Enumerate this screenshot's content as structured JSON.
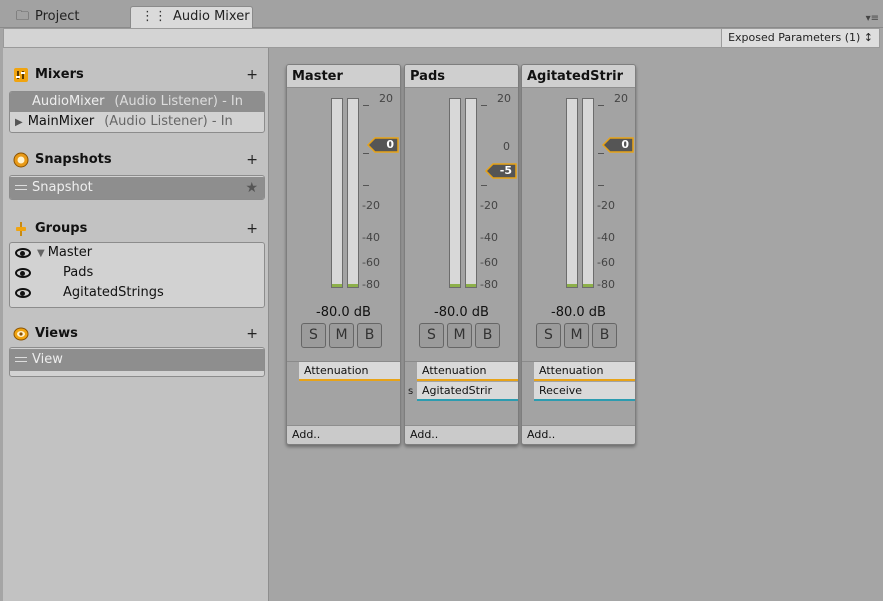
{
  "tabs": [
    {
      "label": "Project",
      "icon": "folder-icon"
    },
    {
      "label": "Audio Mixer",
      "icon": "mixer-icon"
    }
  ],
  "toolbar": {
    "exposed_parameters": "Exposed Parameters (1) ↕"
  },
  "mixers": {
    "title": "Mixers",
    "add": "+",
    "items": [
      {
        "name": "AudioMixer",
        "detail": "(Audio Listener) - In"
      },
      {
        "name": "MainMixer",
        "detail": "(Audio Listener) - In"
      }
    ]
  },
  "snapshots": {
    "title": "Snapshots",
    "add": "+",
    "items": [
      {
        "name": "Snapshot",
        "star": "★"
      }
    ]
  },
  "groups": {
    "title": "Groups",
    "add": "+",
    "items": [
      {
        "name": "Master",
        "arrow": "▼"
      },
      {
        "name": "Pads"
      },
      {
        "name": "AgitatedStrings"
      }
    ]
  },
  "views": {
    "title": "Views",
    "add": "+",
    "items": [
      {
        "name": "View"
      }
    ]
  },
  "strips": [
    {
      "title": "Master",
      "fader_value": "0",
      "level": "-80.0 dB",
      "buttons": [
        "S",
        "M",
        "B"
      ],
      "effects": [
        {
          "label": "Attenuation",
          "color": "#e8a317"
        }
      ],
      "add": "Add.."
    },
    {
      "title": "Pads",
      "fader_value": "-5",
      "level": "-80.0 dB",
      "buttons": [
        "S",
        "M",
        "B"
      ],
      "send_marker": "s",
      "effects": [
        {
          "label": "Attenuation",
          "color": "#e8a317"
        },
        {
          "label": "AgitatedStrir",
          "color": "#2c9cb0"
        }
      ],
      "add": "Add.."
    },
    {
      "title": "AgitatedStrir",
      "fader_value": "0",
      "level": "-80.0 dB",
      "buttons": [
        "S",
        "M",
        "B"
      ],
      "effects": [
        {
          "label": "Attenuation",
          "color": "#e8a317"
        },
        {
          "label": "Receive",
          "color": "#2c9cb0"
        }
      ],
      "add": "Add.."
    }
  ],
  "meter_scale": [
    "20",
    "0",
    "-20",
    "-40",
    "-60",
    "-80"
  ],
  "colors": {
    "accent_orange": "#e8a317",
    "send_teal": "#2c9cb0",
    "meter_green": "#8db04a"
  }
}
